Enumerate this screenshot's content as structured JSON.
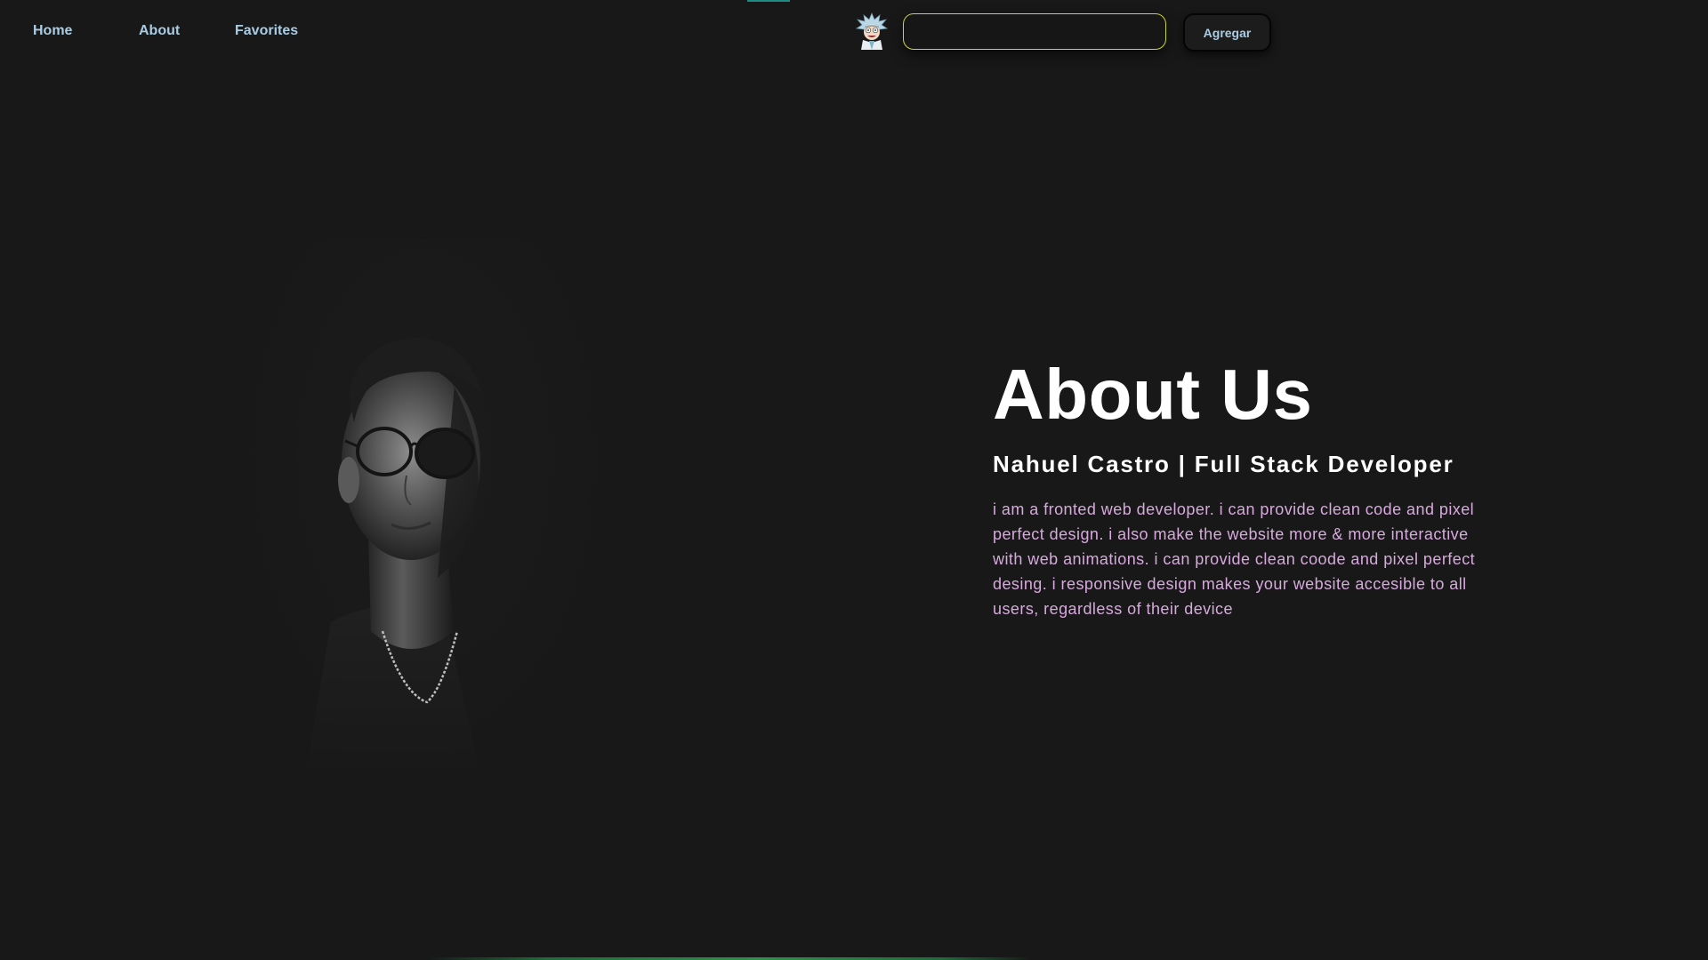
{
  "nav": {
    "links": [
      {
        "label": "Home"
      },
      {
        "label": "About"
      },
      {
        "label": "Favorites"
      }
    ],
    "logo_icon": "rick-avatar-icon",
    "search": {
      "value": "",
      "placeholder": ""
    },
    "add_button_label": "Agregar"
  },
  "about": {
    "title": "About Us",
    "subtitle": "Nahuel Castro | Full Stack Developer",
    "body": "i am a fronted web developer. i can provide clean code and pixel perfect design. i also make the website more & more interactive with web animations. i can provide clean coode and pixel perfect desing. i responsive design makes your website accesible to all users, regardless of their device"
  },
  "colors": {
    "background": "#181818",
    "nav_link": "#a9cce3",
    "input_border": "#c9d33a",
    "body_text": "#d7a9dd",
    "title_text": "#ffffff",
    "accent": "#1f8a83"
  }
}
